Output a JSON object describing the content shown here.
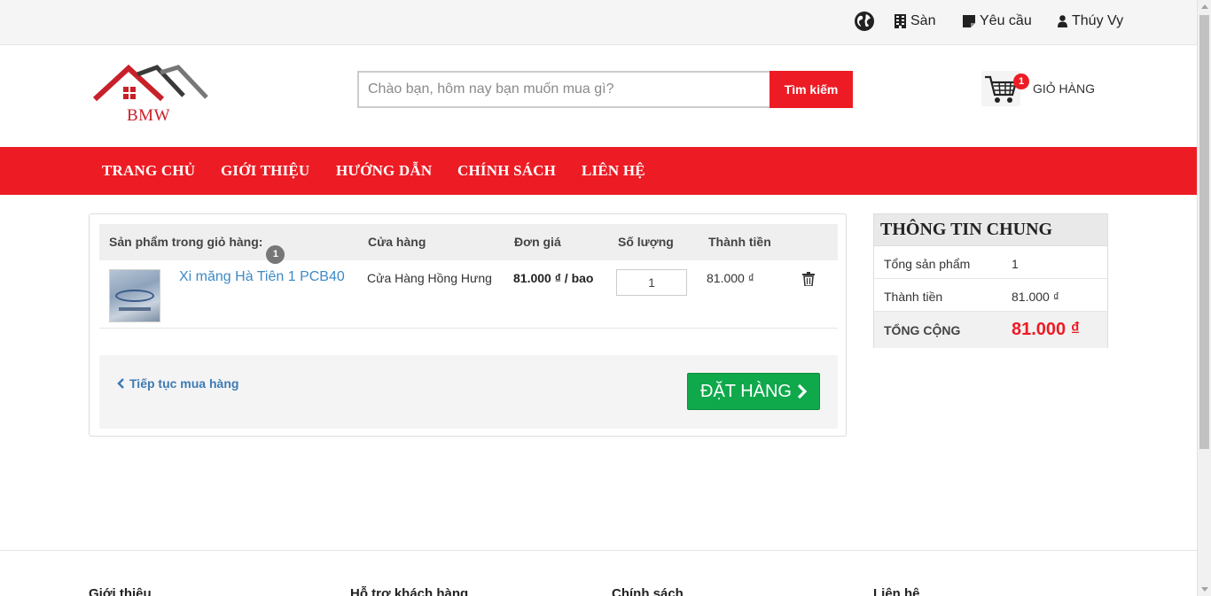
{
  "topbar": {
    "links": [
      {
        "icon": "building-icon",
        "label": "Sàn"
      },
      {
        "icon": "note-icon",
        "label": "Yêu cầu"
      },
      {
        "icon": "user-icon",
        "label": "Thúy Vy"
      }
    ]
  },
  "header": {
    "logo_text": "BMW",
    "search_placeholder": "Chào bạn, hôm nay bạn muốn mua gì?",
    "search_button": "Tìm kiếm",
    "cart_count": "1",
    "cart_label": "GIỎ HÀNG"
  },
  "nav": {
    "items": [
      "TRANG CHỦ",
      "GIỚI THIỆU",
      "HƯỚNG DẪN",
      "CHÍNH SÁCH",
      "LIÊN HỆ"
    ]
  },
  "cart": {
    "headers": {
      "products": "Sản phẩm trong giỏ hàng:",
      "count": "1",
      "shop": "Cửa hàng",
      "unit_price": "Đơn giá",
      "quantity": "Số lượng",
      "total": "Thành tiền"
    },
    "items": [
      {
        "name": "Xi măng Hà Tiên 1 PCB40",
        "shop": "Cửa Hàng Hồng Hưng",
        "price": "81.000 ₫ / bao",
        "quantity": "1",
        "total": "81.000 ₫"
      }
    ],
    "continue_label": "Tiếp tục mua hàng",
    "order_label": "ĐẶT HÀNG"
  },
  "summary": {
    "title": "THÔNG TIN CHUNG",
    "rows": [
      {
        "label": "Tổng sản phẩm",
        "value": "1"
      },
      {
        "label": "Thành tiền",
        "value": "81.000 ₫"
      }
    ],
    "grand_label": "TỔNG CỘNG",
    "grand_value": "81.000 ₫"
  },
  "footer": {
    "columns": [
      "Giới thiệu",
      "Hỗ trợ khách hàng",
      "Chính sách",
      "Liên hệ"
    ]
  },
  "colors": {
    "brand_red": "#ed1c24",
    "order_green": "#0fa84b",
    "link_blue": "#3d8ac6"
  }
}
